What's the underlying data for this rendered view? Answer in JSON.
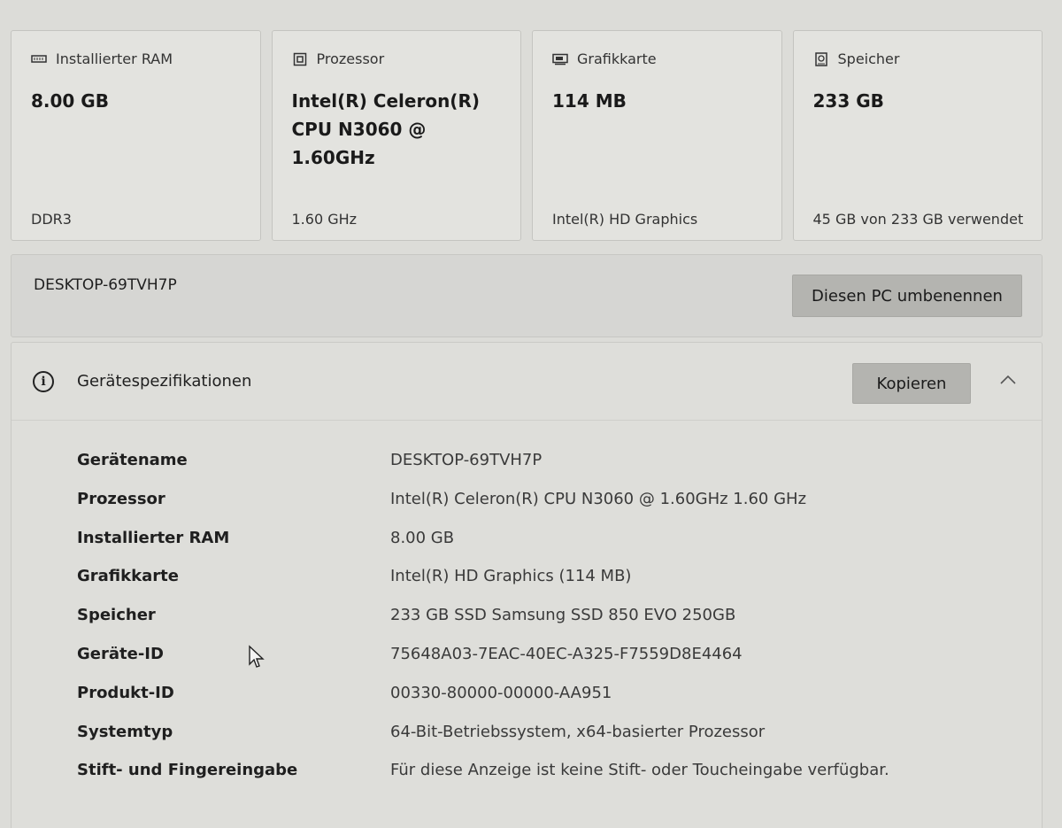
{
  "cards": [
    {
      "title": "Installierter RAM",
      "value": "8.00 GB",
      "sub": "DDR3",
      "icon": "ram-icon"
    },
    {
      "title": "Prozessor",
      "value": "Intel(R) Celeron(R) CPU  N3060  @ 1.60GHz",
      "sub": "1.60 GHz",
      "icon": "processor-icon"
    },
    {
      "title": "Grafikkarte",
      "value": "114 MB",
      "sub": "Intel(R) HD Graphics",
      "icon": "graphics-card-icon"
    },
    {
      "title": "Speicher",
      "value": "233 GB",
      "sub": "45 GB von 233 GB verwendet",
      "icon": "storage-icon"
    }
  ],
  "device": {
    "name": "DESKTOP-69TVH7P",
    "rename_label": "Diesen PC umbenennen"
  },
  "specs": {
    "title": "Gerätespezifikationen",
    "copy_label": "Kopieren",
    "rows": [
      {
        "label": "Gerätename",
        "value": "DESKTOP-69TVH7P"
      },
      {
        "label": "Prozessor",
        "value": "Intel(R) Celeron(R) CPU  N3060  @ 1.60GHz   1.60 GHz"
      },
      {
        "label": "Installierter RAM",
        "value": "8.00 GB"
      },
      {
        "label": "Grafikkarte",
        "value": "Intel(R) HD Graphics (114 MB)"
      },
      {
        "label": "Speicher",
        "value": "233 GB SSD Samsung SSD 850 EVO 250GB"
      },
      {
        "label": "Geräte-ID",
        "value": "75648A03-7EAC-40EC-A325-F7559D8E4464"
      },
      {
        "label": "Produkt-ID",
        "value": "00330-80000-00000-AA951"
      },
      {
        "label": "Systemtyp",
        "value": "64-Bit-Betriebssystem, x64-basierter Prozessor"
      },
      {
        "label": "Stift- und Fingereingabe",
        "value": "Für diese Anzeige ist keine Stift- oder Toucheingabe verfügbar."
      }
    ]
  }
}
